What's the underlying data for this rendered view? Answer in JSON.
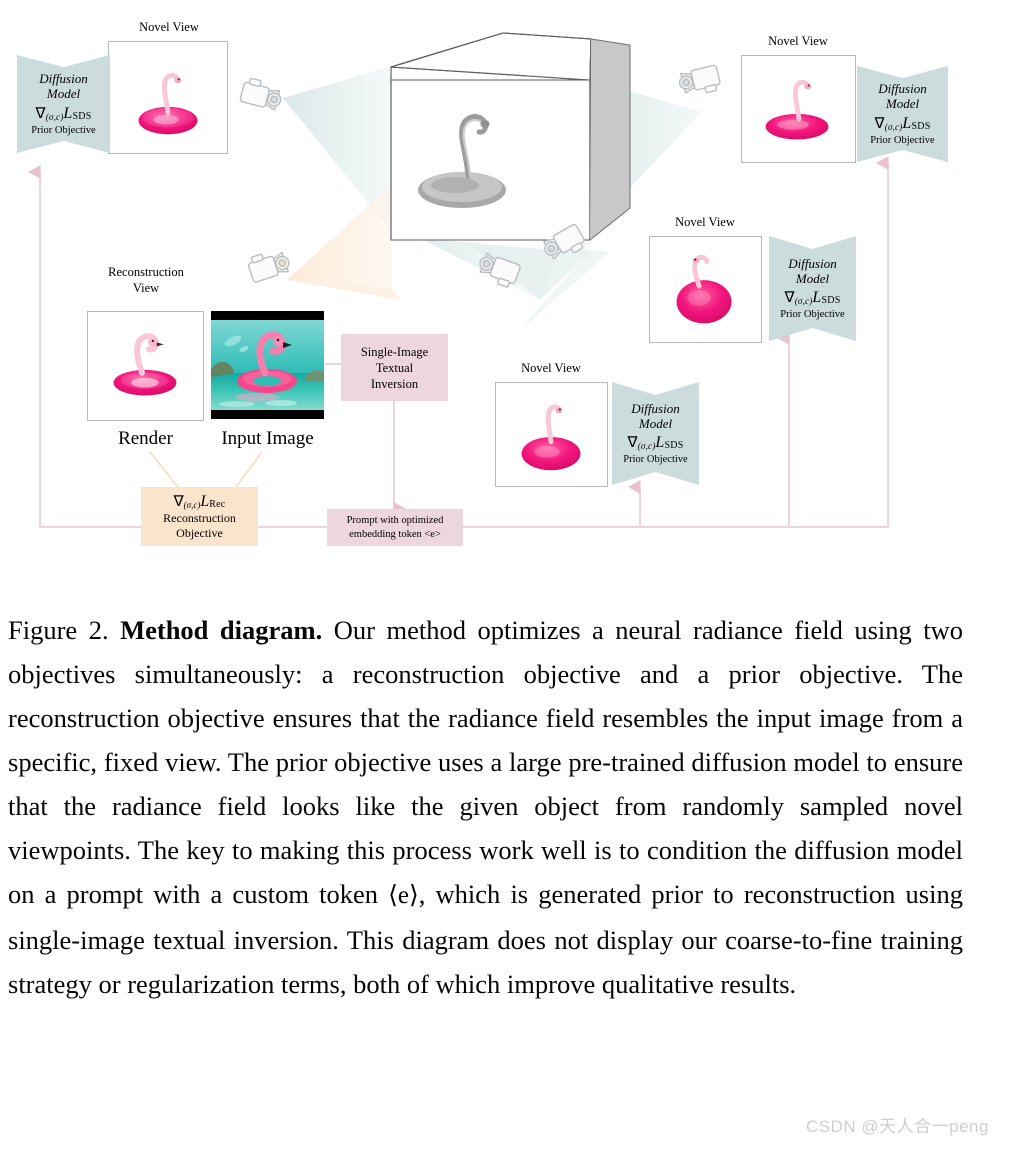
{
  "figure": {
    "diffusion_blocks": [
      {
        "id": "left-top",
        "title_line1": "Diffusion",
        "title_line2": "Model",
        "grad": "∇",
        "grad_sub": "(σ,c)",
        "loss": "L",
        "loss_sub": "SDS",
        "objective": "Prior Objective"
      },
      {
        "id": "right-top",
        "title_line1": "Diffusion",
        "title_line2": "Model",
        "grad": "∇",
        "grad_sub": "(σ,c)",
        "loss": "L",
        "loss_sub": "SDS",
        "objective": "Prior Objective"
      },
      {
        "id": "right-middle",
        "title_line1": "Diffusion",
        "title_line2": "Model",
        "grad": "∇",
        "grad_sub": "(σ,c)",
        "loss": "L",
        "loss_sub": "SDS",
        "objective": "Prior Objective"
      },
      {
        "id": "bottom-center",
        "title_line1": "Diffusion",
        "title_line2": "Model",
        "grad": "∇",
        "grad_sub": "(σ,c)",
        "loss": "L",
        "loss_sub": "SDS",
        "objective": "Prior Objective"
      }
    ],
    "novel_view_labels": [
      "Novel View",
      "Novel View",
      "Novel View",
      "Novel View"
    ],
    "reconstruction_view_label_line1": "Reconstruction",
    "reconstruction_view_label_line2": "View",
    "render_label": "Render",
    "input_image_label": "Input Image",
    "textual_inversion_box": {
      "line1": "Single-Image",
      "line2": "Textual",
      "line3": "Inversion"
    },
    "prompt_box": {
      "line1": "Prompt with optimized",
      "line2": "embedding token <e>"
    },
    "reconstruction_objective_box": {
      "grad": "∇",
      "grad_sub": "(σ,c)",
      "loss": "L",
      "loss_sub": "Rec",
      "line1": "Reconstruction",
      "line2": "Objective"
    },
    "colors": {
      "diffusion_block": "#ccdcdc",
      "pink_box": "#eed6de",
      "peach_box": "#fae4cb",
      "pink_arrow": "#f0d3dc",
      "peach_arrow": "#f8dfc4",
      "frustum_teal": "#dfeaea",
      "frustum_peach": "#fbecd8",
      "flamingo_pink": "#f01f7e"
    }
  },
  "caption": {
    "figure_number": "Figure 2.",
    "bold_title": "Method diagram.",
    "body_part1": "Our method optimizes a neural radiance field using two objectives simultaneously: a reconstruction objective and a prior objective. The reconstruction objective ensures that the radiance field resembles the input image from a specific, fixed view. The prior objective uses a large pre-trained diffusion model to ensure that the radiance field looks like the given object from randomly sampled novel viewpoints. The key to making this process work well is to condition the diffusion model on a prompt with a custom token ",
    "token": "⟨e⟩",
    "body_part2": ", which is generated prior to reconstruction using single-image textual inversion. This diagram does not display our coarse-to-fine training strategy or regularization terms, both of which improve qualitative results."
  },
  "watermark": "CSDN @天人合一peng"
}
